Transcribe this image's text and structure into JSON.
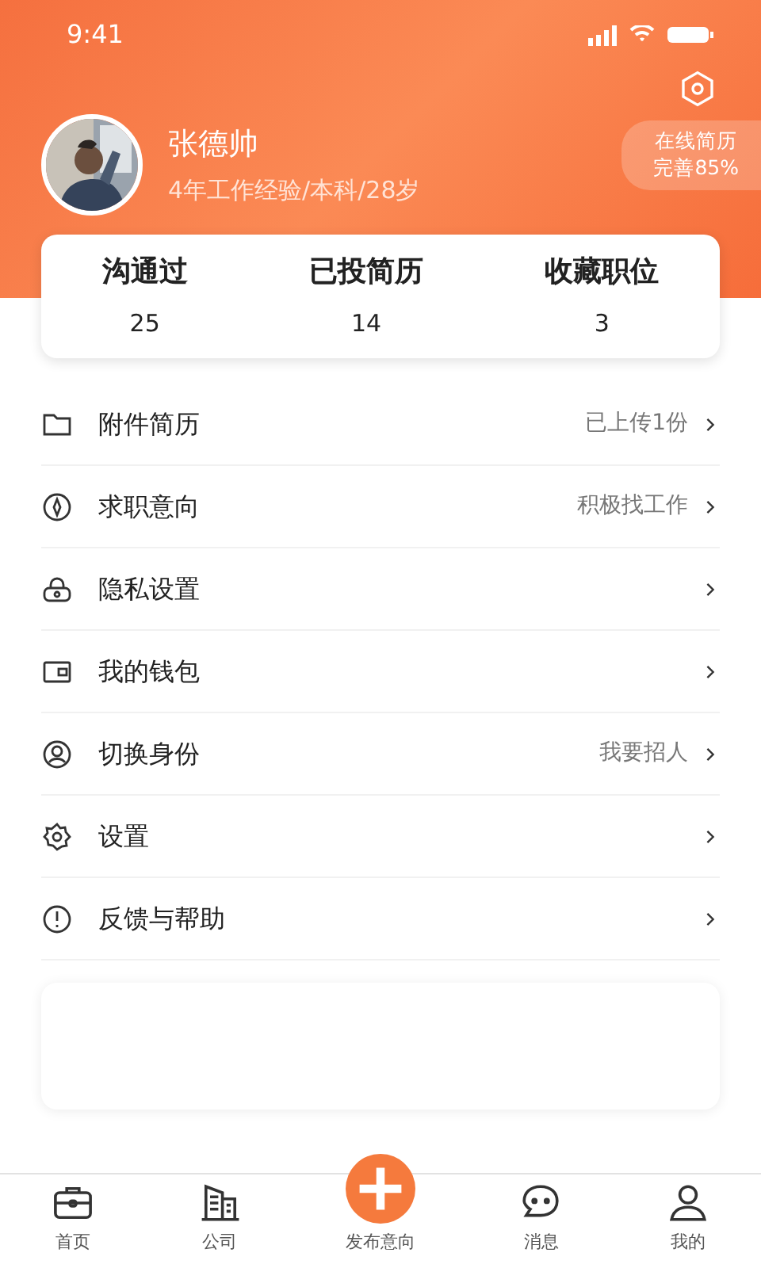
{
  "status_bar": {
    "time": "9:41"
  },
  "profile": {
    "name": "张德帅",
    "details": "4年工作经验/本科/28岁",
    "resume_badge": [
      "在线简历",
      "完善85%"
    ]
  },
  "stats": [
    {
      "label": "沟通过",
      "value": "25"
    },
    {
      "label": "已投简历",
      "value": "14"
    },
    {
      "label": "收藏职位",
      "value": "3"
    }
  ],
  "menu": [
    {
      "kind": "folder",
      "label": "附件简历",
      "value": "已上传1份"
    },
    {
      "kind": "target",
      "label": "求职意向",
      "value": "积极找工作"
    },
    {
      "kind": "lock",
      "label": "隐私设置"
    },
    {
      "kind": "wallet",
      "label": "我的钱包"
    },
    {
      "kind": "user",
      "label": "切换身份",
      "value": "我要招人"
    },
    {
      "kind": "gear",
      "label": "设置"
    },
    {
      "kind": "alert",
      "label": "反馈与帮助"
    }
  ],
  "tab_bar": [
    {
      "kind": "briefcase",
      "label": "首页"
    },
    {
      "kind": "building",
      "label": "公司"
    },
    {
      "kind": "plus",
      "label": "发布意向"
    },
    {
      "kind": "chat",
      "label": "消息"
    },
    {
      "kind": "person",
      "label": "我的"
    }
  ]
}
